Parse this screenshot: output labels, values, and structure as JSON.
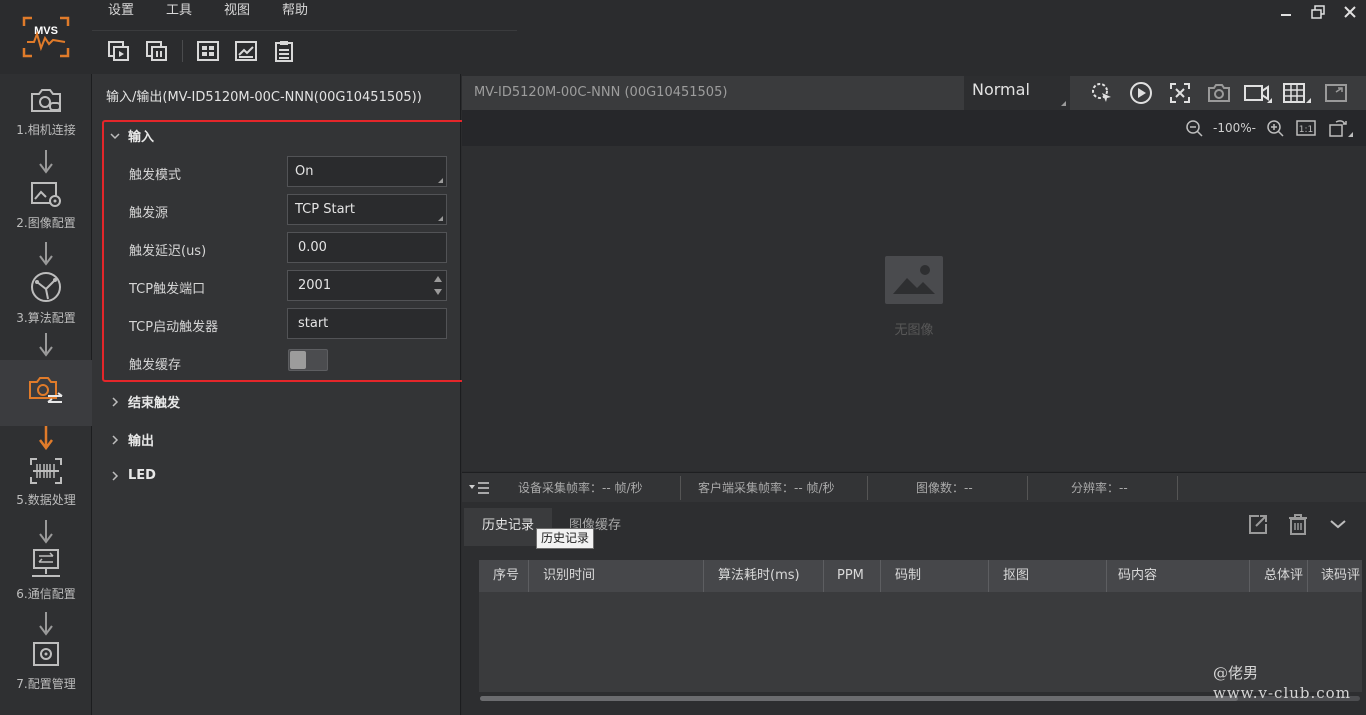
{
  "menu": [
    "设置",
    "工具",
    "视图",
    "帮助"
  ],
  "window_controls": [
    "minimize-icon",
    "restore-icon",
    "close-icon"
  ],
  "steps": [
    {
      "label": "1.相机连接",
      "icon": "camera-link-icon"
    },
    {
      "label": "2.图像配置",
      "icon": "image-settings-icon"
    },
    {
      "label": "3.算法配置",
      "icon": "algorithm-icon"
    },
    {
      "label": "",
      "icon": "camera-io-icon",
      "active": true
    },
    {
      "label": "5.数据处理",
      "icon": "barcode-scan-icon"
    },
    {
      "label": "6.通信配置",
      "icon": "network-icon"
    },
    {
      "label": "7.配置管理",
      "icon": "config-gear-icon"
    }
  ],
  "panel": {
    "title": "输入/输出(MV-ID5120M-00C-NNN(00G10451505))",
    "sections": {
      "input": "输入",
      "end_trigger": "结束触发",
      "output": "输出",
      "led": "LED"
    },
    "fields": {
      "trigger_mode": {
        "label": "触发模式",
        "value": "On"
      },
      "trigger_source": {
        "label": "触发源",
        "value": "TCP Start"
      },
      "trigger_delay": {
        "label": "触发延迟(us)",
        "value": "0.00"
      },
      "tcp_port": {
        "label": "TCP触发端口",
        "value": "2001"
      },
      "tcp_start": {
        "label": "TCP启动触发器",
        "value": "start"
      },
      "trigger_cache": {
        "label": "触发缓存",
        "value": "off"
      }
    }
  },
  "view": {
    "device_title": "MV-ID5120M-00C-NNN (00G10451505)",
    "mode": "Normal",
    "zoom": "-100%-",
    "no_image": "无图像"
  },
  "status": {
    "device_fps": "设备采集帧率：-- 帧/秒",
    "client_fps": "客户端采集帧率：-- 帧/秒",
    "image_count": "图像数：--",
    "resolution": "分辨率：--"
  },
  "bottom": {
    "tabs": [
      "历史记录",
      "图像缓存"
    ],
    "tooltip": "历史记录",
    "columns": [
      "序号",
      "识别时间",
      "算法耗时(ms)",
      "PPM",
      "码制",
      "抠图",
      "码内容",
      "总体评",
      "读码评"
    ]
  },
  "watermark": {
    "line1": "@佬男",
    "line2": "www.v-club.com"
  },
  "colors": {
    "accent_orange": "#e07b2a",
    "highlight_red": "#e4262a",
    "background": "#2b2c2e"
  }
}
